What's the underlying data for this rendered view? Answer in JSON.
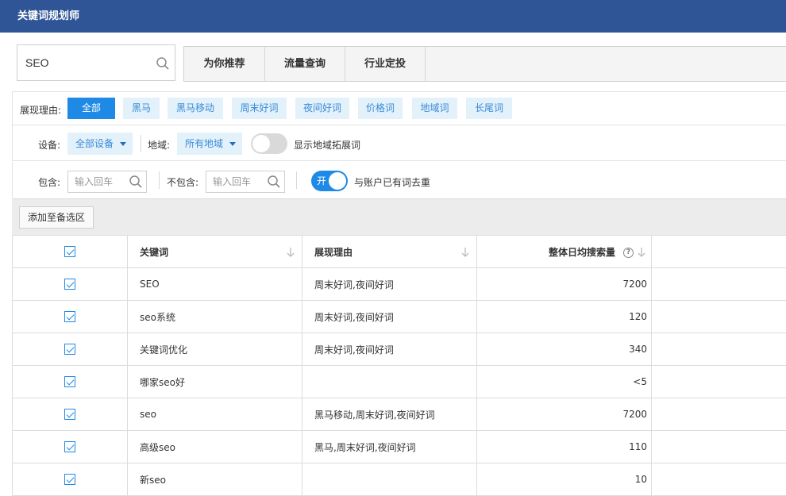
{
  "window": {
    "title": "关键词规划师"
  },
  "search": {
    "value": "SEO"
  },
  "tabs": [
    {
      "label": "为你推荐"
    },
    {
      "label": "流量查询"
    },
    {
      "label": "行业定投"
    }
  ],
  "reasons": {
    "label": "展现理由:",
    "chips": [
      {
        "label": "全部",
        "active": true
      },
      {
        "label": "黑马"
      },
      {
        "label": "黑马移动"
      },
      {
        "label": "周末好词"
      },
      {
        "label": "夜间好词"
      },
      {
        "label": "价格词"
      },
      {
        "label": "地域词"
      },
      {
        "label": "长尾词"
      }
    ]
  },
  "device_row": {
    "device_label": "设备:",
    "device_value": "全部设备",
    "region_label": "地域:",
    "region_value": "所有地域",
    "toggle_label": "显示地域拓展词",
    "toggle_on": false
  },
  "filter_row": {
    "include_label": "包含:",
    "include_placeholder": "输入回车",
    "exclude_label": "不包含:",
    "exclude_placeholder": "输入回车",
    "toggle_text": "开",
    "toggle_on": true,
    "toggle_label": "与账户已有词去重"
  },
  "actions": {
    "add_label": "添加至备选区"
  },
  "table": {
    "headers": {
      "keyword": "关键词",
      "reason": "展现理由",
      "volume": "整体日均搜索量"
    },
    "rows": [
      {
        "keyword": "SEO",
        "reason": "周末好词,夜间好词",
        "volume": "7200"
      },
      {
        "keyword": "seo系统",
        "reason": "周末好词,夜间好词",
        "volume": "120"
      },
      {
        "keyword": "关键词优化",
        "reason": "周末好词,夜间好词",
        "volume": "340"
      },
      {
        "keyword": "哪家seo好",
        "reason": "",
        "volume": "<5"
      },
      {
        "keyword": "seo",
        "reason": "黑马移动,周末好词,夜间好词",
        "volume": "7200"
      },
      {
        "keyword": "高级seo",
        "reason": "黑马,周末好词,夜间好词",
        "volume": "110"
      },
      {
        "keyword": "新seo",
        "reason": "",
        "volume": "10"
      }
    ]
  },
  "colors": {
    "titlebar": "#2f5597",
    "accent": "#1e8ae6",
    "chip_bg": "#e3f1fb",
    "chip_text": "#3a8ad6"
  }
}
